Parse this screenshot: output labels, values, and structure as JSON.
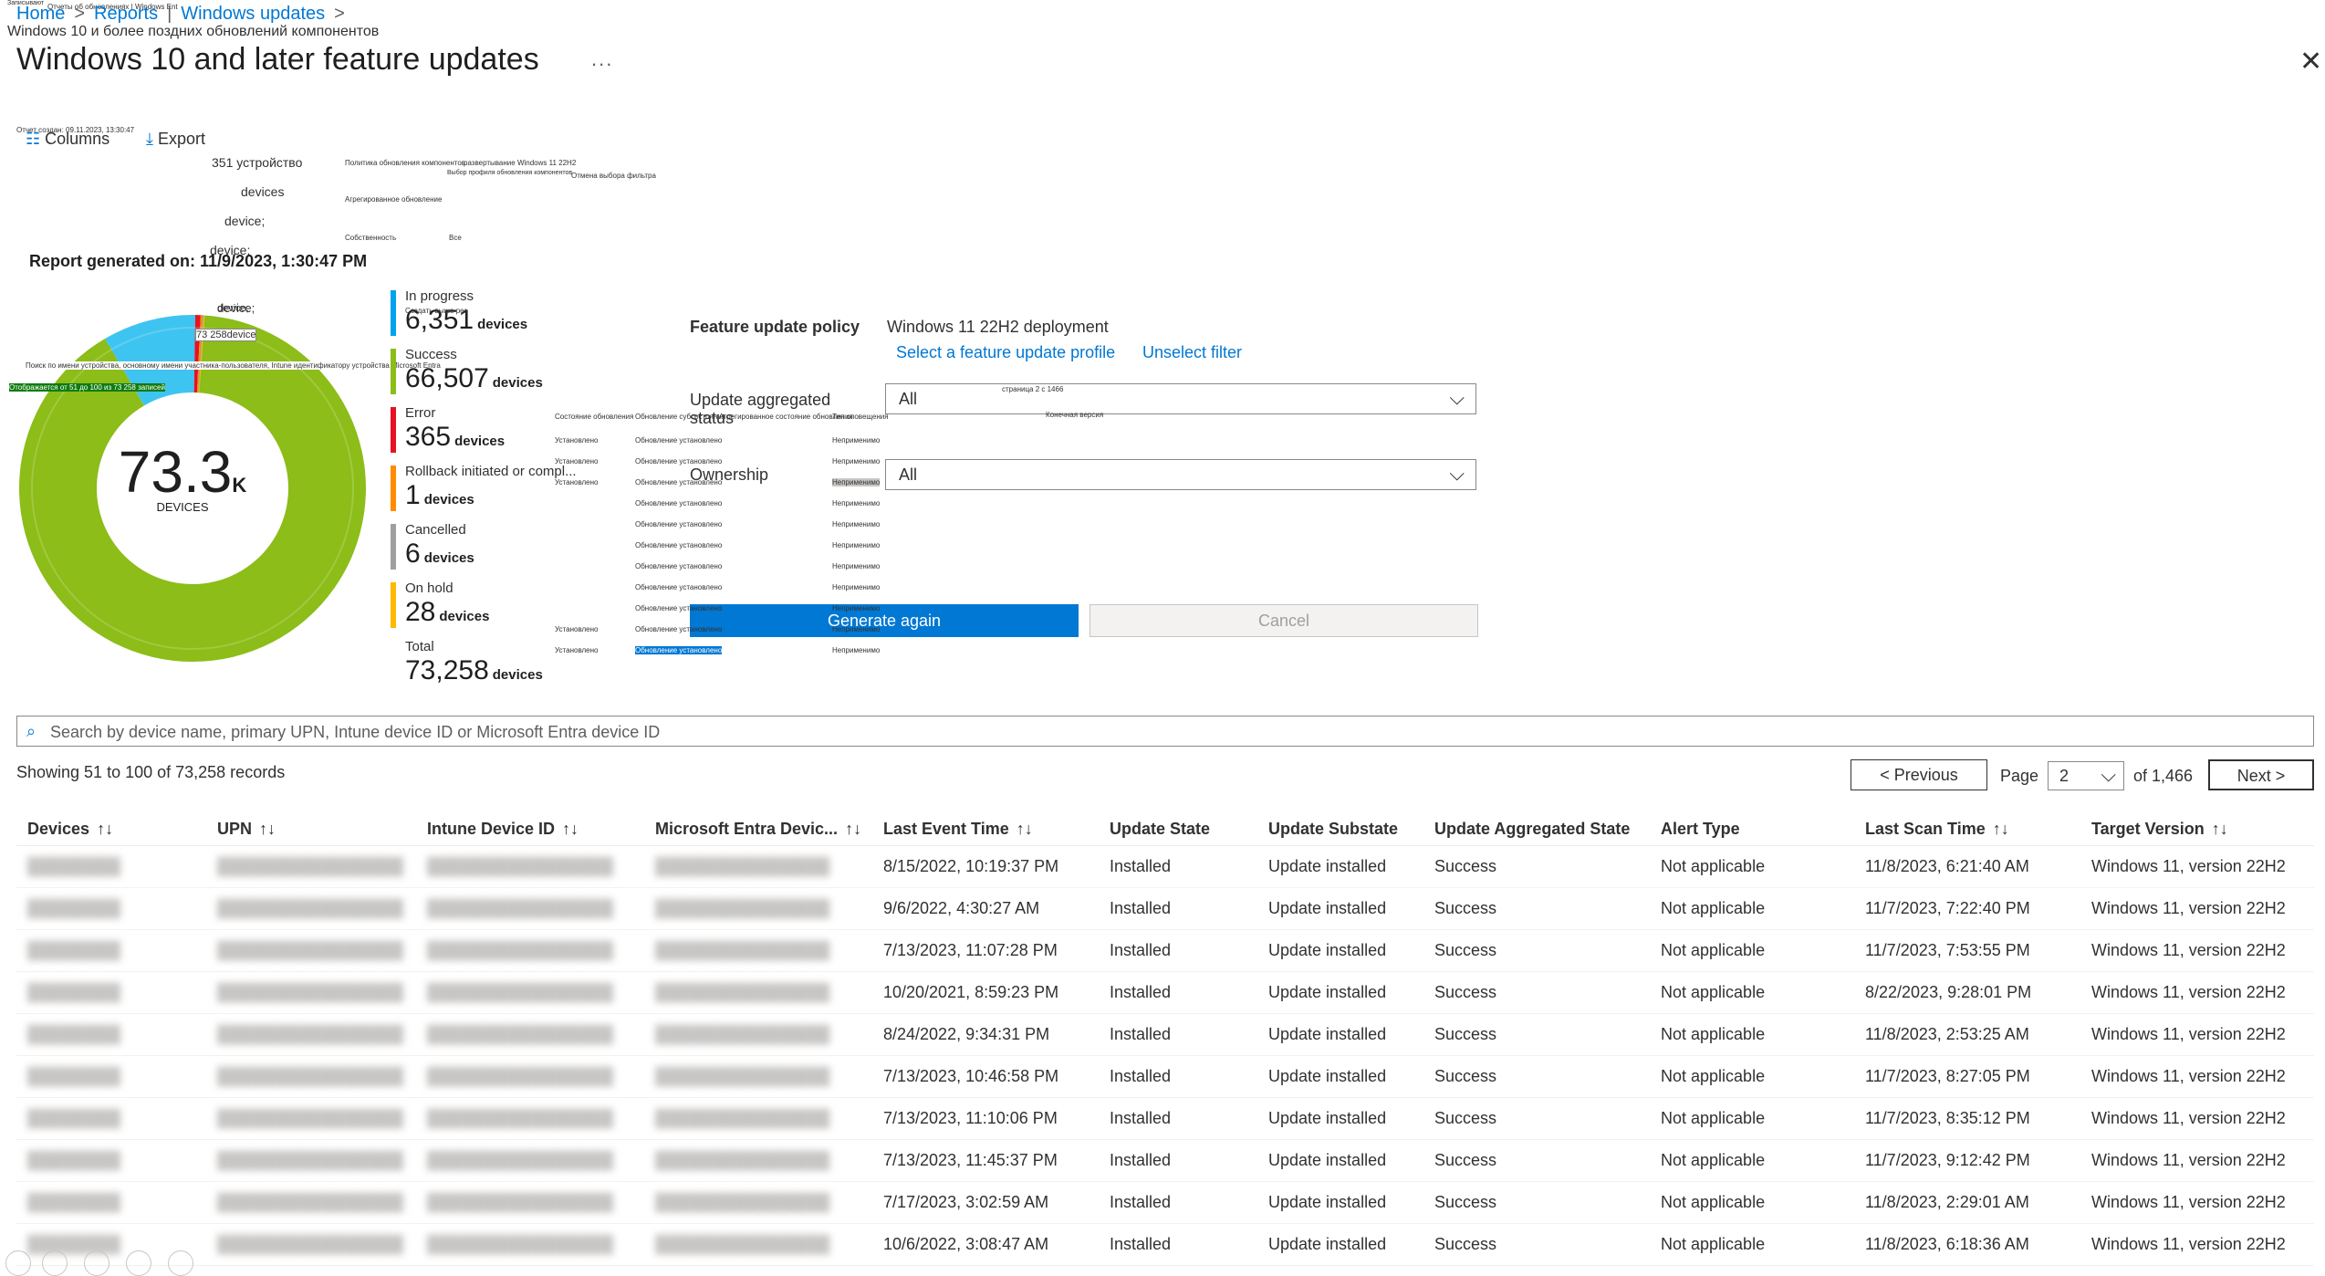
{
  "breadcrumb": {
    "items": [
      "Home",
      "Reports",
      "Windows updates"
    ],
    "ru_line": "Windows 10 и более поздних обновлений компонентов",
    "ru_top": "Отчеты об обновлениях | Windows Ent",
    "ru_top2": "Записывают"
  },
  "header": {
    "title": "Windows 10 and later feature updates",
    "more": "...",
    "close": "✕"
  },
  "toolbar": {
    "columns_label": "Columns",
    "export_label": "Export",
    "ru_created": "Отчет создан: 09.11.2023, 13:30:47"
  },
  "report_generated": "Report generated on: 11/9/2023, 1:30:47 PM",
  "donut": {
    "value": "73.3",
    "suffix": "K",
    "label": "DEVICES",
    "segments": [
      {
        "name": "Success",
        "value": 66507,
        "color": "#8cbd18"
      },
      {
        "name": "In progress",
        "value": 6351,
        "color": "#3ec4f0"
      },
      {
        "name": "Error",
        "value": 365,
        "color": "#e81123"
      },
      {
        "name": "Rollback initiated or completed",
        "value": 1,
        "color": "#ff8c00"
      },
      {
        "name": "Cancelled",
        "value": 6,
        "color": "#a19f9d"
      },
      {
        "name": "On hold",
        "value": 28,
        "color": "#ffb900"
      }
    ]
  },
  "legend": {
    "unit": "devices",
    "items": [
      {
        "name": "In progress",
        "count": "6,351",
        "color": "#00a2ed"
      },
      {
        "name": "Success",
        "count": "66,507",
        "color": "#8cbd18"
      },
      {
        "name": "Error",
        "count": "365",
        "color": "#e81123"
      },
      {
        "name": "Rollback initiated or compl...",
        "count": "1",
        "color": "#ff8c00"
      },
      {
        "name": "Cancelled",
        "count": "6",
        "color": "#a19f9d"
      },
      {
        "name": "On hold",
        "count": "28",
        "color": "#ffb900"
      }
    ],
    "total_label": "Total",
    "total_count": "73,258"
  },
  "ru_overlay": {
    "devices_351": "351 устройство",
    "devices": "devices",
    "device1": "device;",
    "device2": "device;",
    "device3": "device;",
    "devices_73258": "73 258device",
    "create_above": "Создать выше рез",
    "policy_ru": "Политика обновления компонентов",
    "deploy_ru": "развертывание Windows 11 22H2",
    "select_profile_ru": "Выбор профиля обновления компонентов",
    "unselect_ru": "Отмена выбора фильтра",
    "aggregated_ru": "Агрегированное обновление",
    "ownership_ru": "Собственность",
    "all_ru": "Все",
    "search_ru": "Поиск по имени устройства, основному имени участника-пользователя, Intune идентификатору устройства Microsoft Entra",
    "showing_ru": "Отображается от 51 до 100 из 73 258 записей",
    "page_ru": "страница 2 с 1466",
    "target_ru": "Конечная версия",
    "col_state_ru": "Состояние обновления",
    "col_substate_ru": "Обновление субсостояния",
    "col_aggregated_ru": "Агрегированное состояние обновления",
    "col_alert_ru": "Тип оповещения",
    "installed_ru": "Установлено",
    "update_installed_ru": "Обновление установлено",
    "not_applicable_ru": "Неприменимо"
  },
  "filters": {
    "policy_label": "Feature update policy",
    "policy_value": "Windows 11 22H2 deployment",
    "select_profile": "Select a feature update profile",
    "unselect": "Unselect filter",
    "aggregated_label": "Update aggregated status",
    "aggregated_value": "All",
    "ownership_label": "Ownership",
    "ownership_value": "All",
    "generate": "Generate again",
    "cancel": "Cancel"
  },
  "search": {
    "placeholder": "Search by device name, primary UPN, Intune device ID or Microsoft Entra device ID"
  },
  "showing": "Showing 51 to 100 of 73,258 records",
  "pager": {
    "previous": "< Previous",
    "page_label": "Page",
    "page_value": "2",
    "of": "of 1,466",
    "next": "Next >"
  },
  "table": {
    "columns": [
      "Devices",
      "UPN",
      "Intune Device ID",
      "Microsoft Entra Devic...",
      "Last Event Time",
      "Update State",
      "Update Substate",
      "Update Aggregated State",
      "Alert Type",
      "Last Scan Time",
      "Target Version"
    ],
    "rows": [
      [
        "████████",
        "████████████████",
        "████████████████",
        "███████████████",
        "8/15/2022, 10:19:37 PM",
        "Installed",
        "Update installed",
        "Success",
        "Not applicable",
        "11/8/2023, 6:21:40 AM",
        "Windows 11, version 22H2"
      ],
      [
        "████████",
        "████████████████",
        "████████████████",
        "███████████████",
        "9/6/2022, 4:30:27 AM",
        "Installed",
        "Update installed",
        "Success",
        "Not applicable",
        "11/7/2023, 7:22:40 PM",
        "Windows 11, version 22H2"
      ],
      [
        "████████",
        "████████████████",
        "████████████████",
        "███████████████",
        "7/13/2023, 11:07:28 PM",
        "Installed",
        "Update installed",
        "Success",
        "Not applicable",
        "11/7/2023, 7:53:55 PM",
        "Windows 11, version 22H2"
      ],
      [
        "████████",
        "████████████████",
        "████████████████",
        "███████████████",
        "10/20/2021, 8:59:23 PM",
        "Installed",
        "Update installed",
        "Success",
        "Not applicable",
        "8/22/2023, 9:28:01 PM",
        "Windows 11, version 22H2"
      ],
      [
        "████████",
        "████████████████",
        "████████████████",
        "███████████████",
        "8/24/2022, 9:34:31 PM",
        "Installed",
        "Update installed",
        "Success",
        "Not applicable",
        "11/8/2023, 2:53:25 AM",
        "Windows 11, version 22H2"
      ],
      [
        "████████",
        "████████████████",
        "████████████████",
        "███████████████",
        "7/13/2023, 10:46:58 PM",
        "Installed",
        "Update installed",
        "Success",
        "Not applicable",
        "11/7/2023, 8:27:05 PM",
        "Windows 11, version 22H2"
      ],
      [
        "████████",
        "████████████████",
        "████████████████",
        "███████████████",
        "7/13/2023, 11:10:06 PM",
        "Installed",
        "Update installed",
        "Success",
        "Not applicable",
        "11/7/2023, 8:35:12 PM",
        "Windows 11, version 22H2"
      ],
      [
        "████████",
        "████████████████",
        "████████████████",
        "███████████████",
        "7/13/2023, 11:45:37 PM",
        "Installed",
        "Update installed",
        "Success",
        "Not applicable",
        "11/7/2023, 9:12:42 PM",
        "Windows 11, version 22H2"
      ],
      [
        "████████",
        "████████████████",
        "████████████████",
        "███████████████",
        "7/17/2023, 3:02:59 AM",
        "Installed",
        "Update installed",
        "Success",
        "Not applicable",
        "11/8/2023, 2:29:01 AM",
        "Windows 11, version 22H2"
      ],
      [
        "████████",
        "████████████████",
        "████████████████",
        "███████████████",
        "10/6/2022, 3:08:47 AM",
        "Installed",
        "Update installed",
        "Success",
        "Not applicable",
        "11/8/2023, 6:18:36 AM",
        "Windows 11, version 22H2"
      ]
    ]
  }
}
